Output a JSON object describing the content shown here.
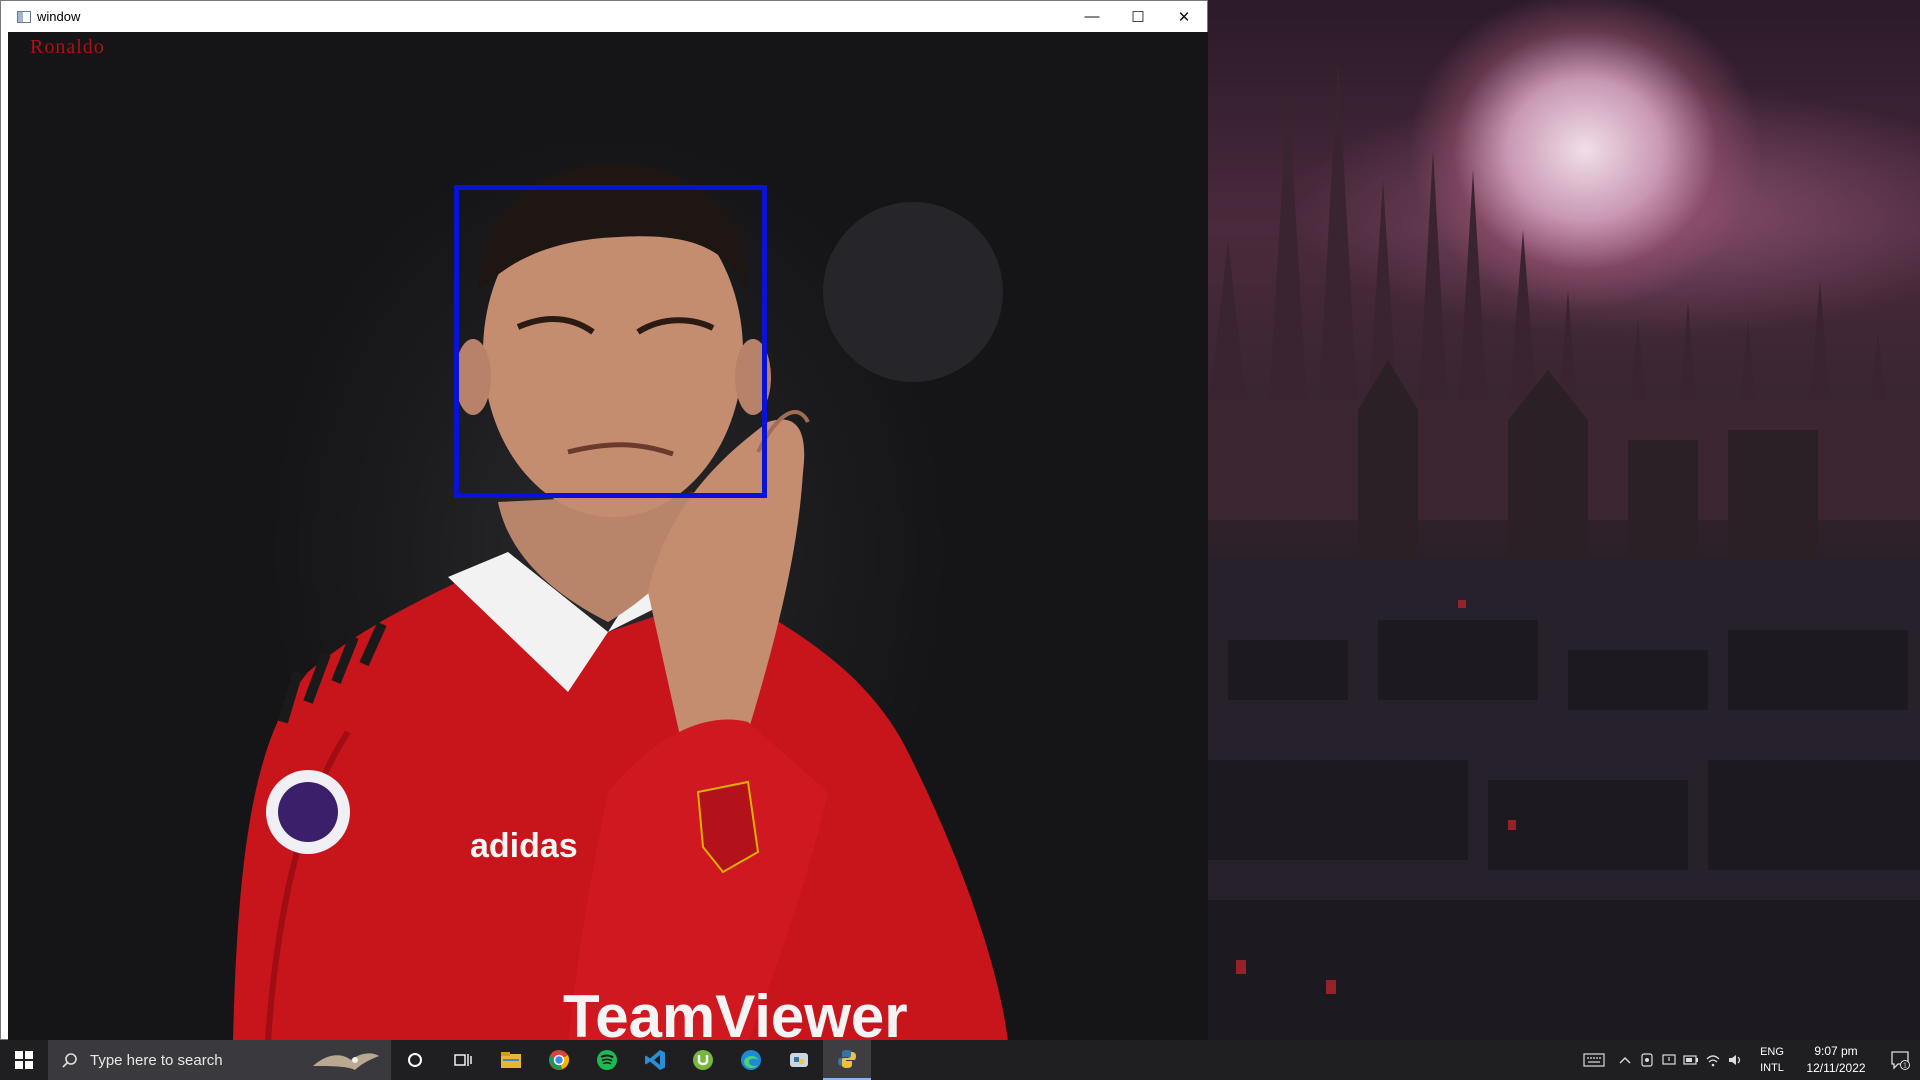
{
  "window": {
    "title": "window",
    "controls": {
      "minimize": "—",
      "maximize": "☐",
      "close": "✕"
    }
  },
  "canvas": {
    "label": "Ronaldo",
    "label_color": "#b01010",
    "box_color": "#0a12d8"
  },
  "taskbar": {
    "search_placeholder": "Type here to search",
    "apps": [
      {
        "name": "cortana-icon"
      },
      {
        "name": "task-view-icon"
      },
      {
        "name": "file-explorer-icon"
      },
      {
        "name": "chrome-icon"
      },
      {
        "name": "spotify-icon"
      },
      {
        "name": "vscode-icon"
      },
      {
        "name": "utorrent-icon"
      },
      {
        "name": "edge-icon"
      },
      {
        "name": "python-idle-icon"
      },
      {
        "name": "python-icon"
      }
    ],
    "lang_line1": "ENG",
    "lang_line2": "INTL",
    "time": "9:07 pm",
    "date": "12/11/2022",
    "notification_count": "1"
  }
}
